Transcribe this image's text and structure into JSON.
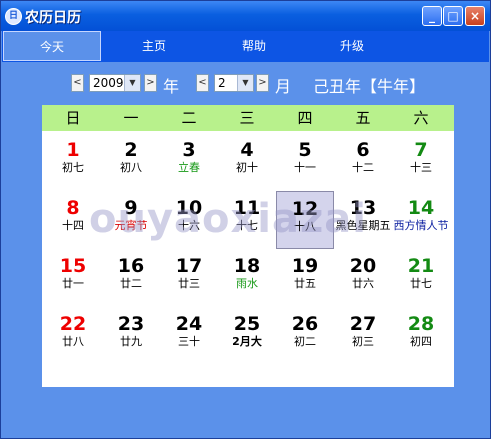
{
  "window": {
    "title": "农历日历",
    "app_icon": "日"
  },
  "menu": [
    {
      "label": "今天",
      "active": true
    },
    {
      "label": "主页",
      "active": false
    },
    {
      "label": "帮助",
      "active": false
    },
    {
      "label": "升级",
      "active": false
    }
  ],
  "nav": {
    "year_value": "2009",
    "year_label": "年",
    "month_value": "2",
    "month_label": "月",
    "ganzhi": "己丑年【牛年】"
  },
  "weekdays": [
    "日",
    "一",
    "二",
    "三",
    "四",
    "五",
    "六"
  ],
  "weeks": [
    [
      {
        "day": "1",
        "sub": "初七",
        "color": "red"
      },
      {
        "day": "2",
        "sub": "初八",
        "color": "black"
      },
      {
        "day": "3",
        "sub": "立春",
        "color": "black",
        "sub_color": "green"
      },
      {
        "day": "4",
        "sub": "初十",
        "color": "black"
      },
      {
        "day": "5",
        "sub": "十一",
        "color": "black"
      },
      {
        "day": "6",
        "sub": "十二",
        "color": "black"
      },
      {
        "day": "7",
        "sub": "十三",
        "color": "green"
      }
    ],
    [
      {
        "day": "8",
        "sub": "十四",
        "color": "red"
      },
      {
        "day": "9",
        "sub": "元宵节",
        "color": "black",
        "sub_color": "red"
      },
      {
        "day": "10",
        "sub": "十六",
        "color": "black"
      },
      {
        "day": "11",
        "sub": "十七",
        "color": "black"
      },
      {
        "day": "12",
        "sub": "十八",
        "color": "black",
        "today": true
      },
      {
        "day": "13",
        "sub": "黑色星期五",
        "color": "black"
      },
      {
        "day": "14",
        "sub": "西方情人节",
        "color": "green",
        "sub_color": "blue"
      }
    ],
    [
      {
        "day": "15",
        "sub": "廿一",
        "color": "red"
      },
      {
        "day": "16",
        "sub": "廿二",
        "color": "black"
      },
      {
        "day": "17",
        "sub": "廿三",
        "color": "black"
      },
      {
        "day": "18",
        "sub": "雨水",
        "color": "black",
        "sub_color": "green"
      },
      {
        "day": "19",
        "sub": "廿五",
        "color": "black"
      },
      {
        "day": "20",
        "sub": "廿六",
        "color": "black"
      },
      {
        "day": "21",
        "sub": "廿七",
        "color": "green"
      }
    ],
    [
      {
        "day": "22",
        "sub": "廿八",
        "color": "red"
      },
      {
        "day": "23",
        "sub": "廿九",
        "color": "black"
      },
      {
        "day": "24",
        "sub": "三十",
        "color": "black"
      },
      {
        "day": "25",
        "sub": "2月大",
        "color": "black",
        "sub_bold": true
      },
      {
        "day": "26",
        "sub": "初二",
        "color": "black"
      },
      {
        "day": "27",
        "sub": "初三",
        "color": "black"
      },
      {
        "day": "28",
        "sub": "初四",
        "color": "green"
      }
    ]
  ],
  "watermark": "ouyaoxiazai",
  "colors": {
    "titlebar": "#0a5fe0",
    "menubar": "#0d55e4",
    "body": "#5b91ea",
    "weekday_header": "#b8f18c"
  }
}
